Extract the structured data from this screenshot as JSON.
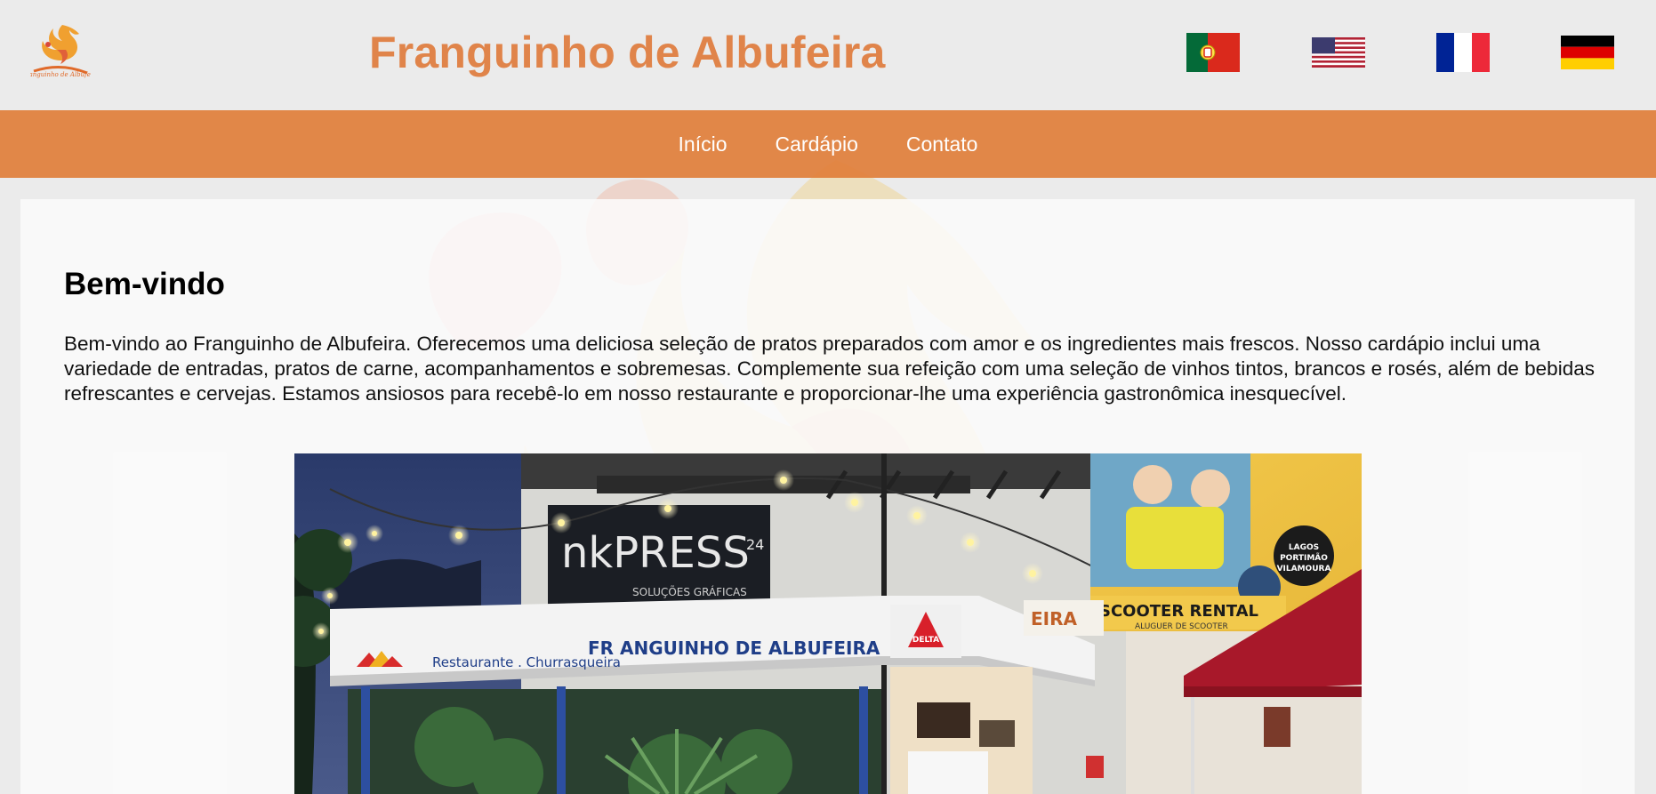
{
  "header": {
    "title": "Franguinho de Albufeira",
    "logo_text": "Franguinho de Albufeira"
  },
  "languages": [
    {
      "code": "pt",
      "icon": "portugal-flag-icon"
    },
    {
      "code": "en",
      "icon": "usa-flag-icon"
    },
    {
      "code": "fr",
      "icon": "france-flag-icon"
    },
    {
      "code": "de",
      "icon": "germany-flag-icon"
    }
  ],
  "nav": {
    "items": [
      {
        "label": "Início"
      },
      {
        "label": "Cardápio"
      },
      {
        "label": "Contato"
      }
    ]
  },
  "main": {
    "heading": "Bem-vindo",
    "intro": "Bem-vindo ao Franguinho de Albufeira. Oferecemos uma deliciosa seleção de pratos preparados com amor e os ingredientes mais frescos. Nosso cardápio inclui uma variedade de entradas, pratos de carne, acompanhamentos e sobremesas. Complemente sua refeição com uma seleção de vinhos tintos, brancos e rosés, além de bebidas refrescantes e cervejas. Estamos ansiosos para recebê-lo em nosso restaurante e proporcionar-lhe uma experiência gastronômica inesquecível."
  },
  "photo": {
    "sign_main": "FR ANGUINHO DE ALBUFEIRA",
    "sign_sub": "Restaurante . Churrasqueira",
    "inkpress": "nkPRESS",
    "inkpress_num": "24",
    "inkpress_sub": "SOLUÇÕES GRÁFICAS",
    "delta": "DELTA",
    "scooter": "SCOOTER RENTAL",
    "scooter_sub": "ALUGUER DE SCOOTER",
    "badge_1": "LAGOS",
    "badge_2": "PORTIMÃO",
    "badge_3": "VILAMOURA",
    "partial_sign": "EIRA"
  },
  "colors": {
    "accent": "#e0844a",
    "nav_bg": "#e07c36",
    "page_bg": "#ebebeb"
  }
}
